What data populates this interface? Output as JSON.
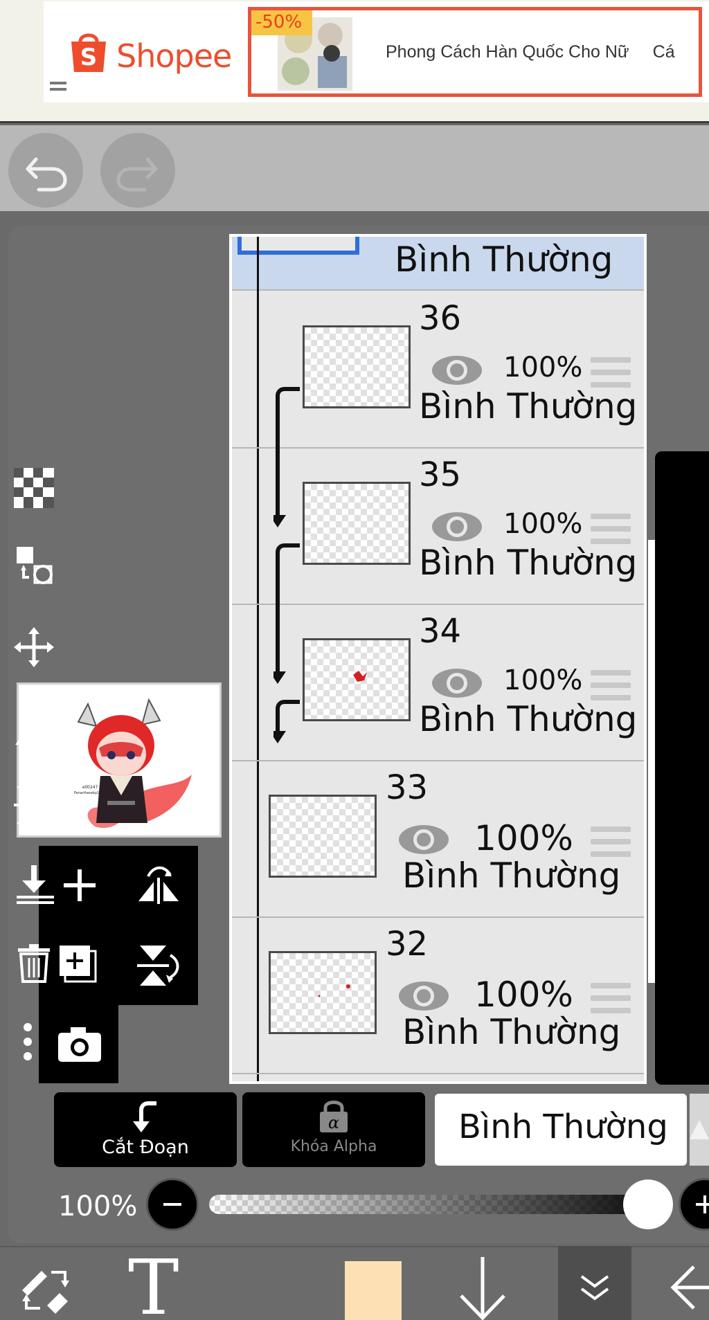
{
  "ad": {
    "brand": "Shopee",
    "discount": "-50%",
    "product_title": "Phong Cách Hàn Quốc Cho Nữ",
    "product_title_2": "Cá",
    "brand_color": "#ee4d2d"
  },
  "toolbar": {
    "undo_icon": "undo-icon",
    "redo_icon": "redo-icon"
  },
  "layer_panel": {
    "top_layer_blend": "Bình Thường",
    "layers": [
      {
        "number": "36",
        "opacity": "100%",
        "blend": "Bình Thường",
        "clipped": true
      },
      {
        "number": "35",
        "opacity": "100%",
        "blend": "Bình Thường",
        "clipped": true
      },
      {
        "number": "34",
        "opacity": "100%",
        "blend": "Bình Thường",
        "clipped": true
      },
      {
        "number": "33",
        "opacity": "100%",
        "blend": "Bình Thường",
        "clipped": false
      },
      {
        "number": "32",
        "opacity": "100%",
        "blend": "Bình Thường",
        "clipped": false
      }
    ]
  },
  "preview": {
    "caption_line1": "ell0247",
    "caption_line2": "Fanarthereby11"
  },
  "bottom_controls": {
    "clip_label": "Cắt Đoạn",
    "alpha_lock_label": "Khóa Alpha",
    "blend_mode": "Bình Thường",
    "opacity_label": "100%",
    "opacity_value": 1.0
  },
  "bottom_bar": {
    "text_tool": "T",
    "current_color": "#fde0b4"
  }
}
